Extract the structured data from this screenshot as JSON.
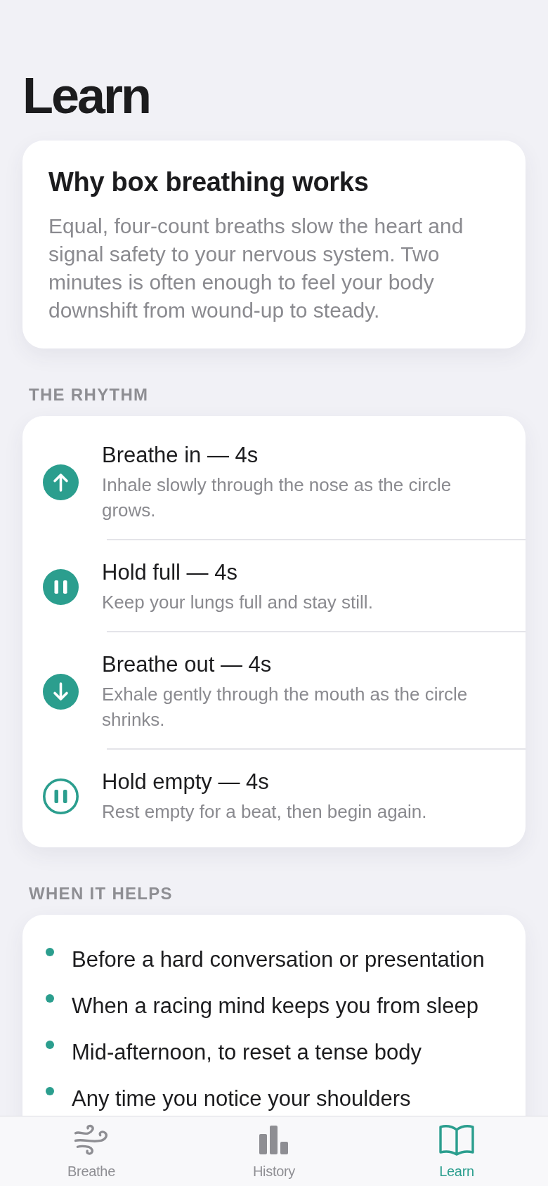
{
  "page_title": "Learn",
  "intro_card": {
    "title": "Why box breathing works",
    "body": "Equal, four-count breaths slow the heart and signal safety to your nervous system. Two minutes is often enough to feel your body downshift from wound-up to steady."
  },
  "rhythm": {
    "heading": "THE RHYTHM",
    "steps": [
      {
        "kind": "inhale",
        "title": "Breathe in — 4s",
        "description": "Inhale slowly through the nose as the circle grows."
      },
      {
        "kind": "hold_full",
        "title": "Hold full — 4s",
        "description": "Keep your lungs full and stay still."
      },
      {
        "kind": "exhale",
        "title": "Breathe out — 4s",
        "description": "Exhale gently through the mouth as the circle shrinks."
      },
      {
        "kind": "hold_empty",
        "title": "Hold empty — 4s",
        "description": "Rest empty for a beat, then begin again."
      }
    ]
  },
  "when_it_helps": {
    "heading": "WHEN IT HELPS",
    "items": [
      "Before a hard conversation or presentation",
      "When a racing mind keeps you from sleep",
      "Mid-afternoon, to reset a tense body",
      "Any time you notice your shoulders"
    ]
  },
  "tab_bar": [
    {
      "kind": "wind",
      "label": "Breathe",
      "selected": false
    },
    {
      "kind": "chart",
      "label": "History",
      "selected": false
    },
    {
      "kind": "book",
      "label": "Learn",
      "selected": true
    }
  ]
}
